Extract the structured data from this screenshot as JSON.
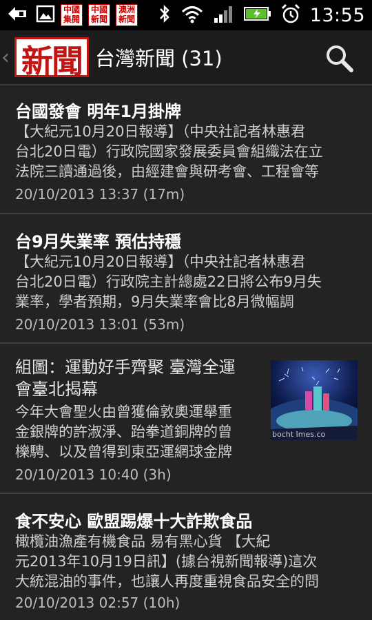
{
  "status": {
    "time": "13:55",
    "mini_logos": [
      {
        "line1": "中國",
        "line2": "集閱"
      },
      {
        "line1": "中國",
        "line2": "新聞"
      },
      {
        "line1": "澳洲",
        "line2": "新聞"
      }
    ]
  },
  "actionbar": {
    "logo_text": "新聞",
    "title": "台灣新聞 (31)"
  },
  "items": [
    {
      "title": "台國發會 明年1月掛牌",
      "lines": [
        "【大紀元10月20日報導】（中央社記者林惠君",
        "台北20日電）行政院國家發展委員會組織法在立",
        "法院三讀通過後，由經建會與研考會、工程會等"
      ],
      "date": "20/10/2013 13:37 (17m)"
    },
    {
      "title": "台9月失業率 預估持穩",
      "lines": [
        "【大紀元10月20日報導】（中央社記者林惠君",
        "台北20日電）行政院主計總處22日將公布9月失",
        "業率，學者預期，9月失業率會比8月微幅調"
      ],
      "date": "20/10/2013 13:01 (53m)"
    },
    {
      "title_lines": [
        "組圖：運動好手齊聚 臺灣全運",
        "會臺北揭幕"
      ],
      "lines": [
        "今年大會聖火由曾獲倫敦奧運舉重",
        "金銀牌的許淑淨、跆拳道銅牌的曾",
        "櫟騁、以及曾得到東亞運網球金牌"
      ],
      "date": "20/10/2013 10:40 (3h)",
      "thumb_caption": "bocht Imes.co"
    },
    {
      "title": "食不安心 歐盟踢爆十大詐欺食品",
      "lines": [
        "橄欖油漁產有機食品 易有黑心貨 【大紀",
        "元2013年10月19日訊】(據台視新聞報導)這次",
        "大統混油的事件，也讓人再度重視食品安全的問"
      ],
      "date": "20/10/2013 02:57 (10h)"
    }
  ]
}
